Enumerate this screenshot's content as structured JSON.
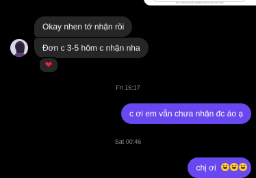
{
  "top_card": {
    "caption": "Bạn đánh giá trải nghiệm này ra sao thế nào?"
  },
  "messages": [
    {
      "side": "in",
      "text": "Okay nhen tớ nhận rồi"
    },
    {
      "side": "in",
      "text": "Đơn c 3-5 hôm c nhận nha"
    },
    {
      "side": "out",
      "text": "c ơi em vẫn chưa nhận đc áo ạ"
    },
    {
      "side": "out",
      "text": "chị ơi"
    }
  ],
  "reaction": {
    "emoji": "❤"
  },
  "timestamps": [
    "Fri 16:17",
    "Sat 00:46"
  ],
  "colors": {
    "outgoing": "#6a48f0",
    "incoming": "#262626",
    "background": "#000000"
  }
}
